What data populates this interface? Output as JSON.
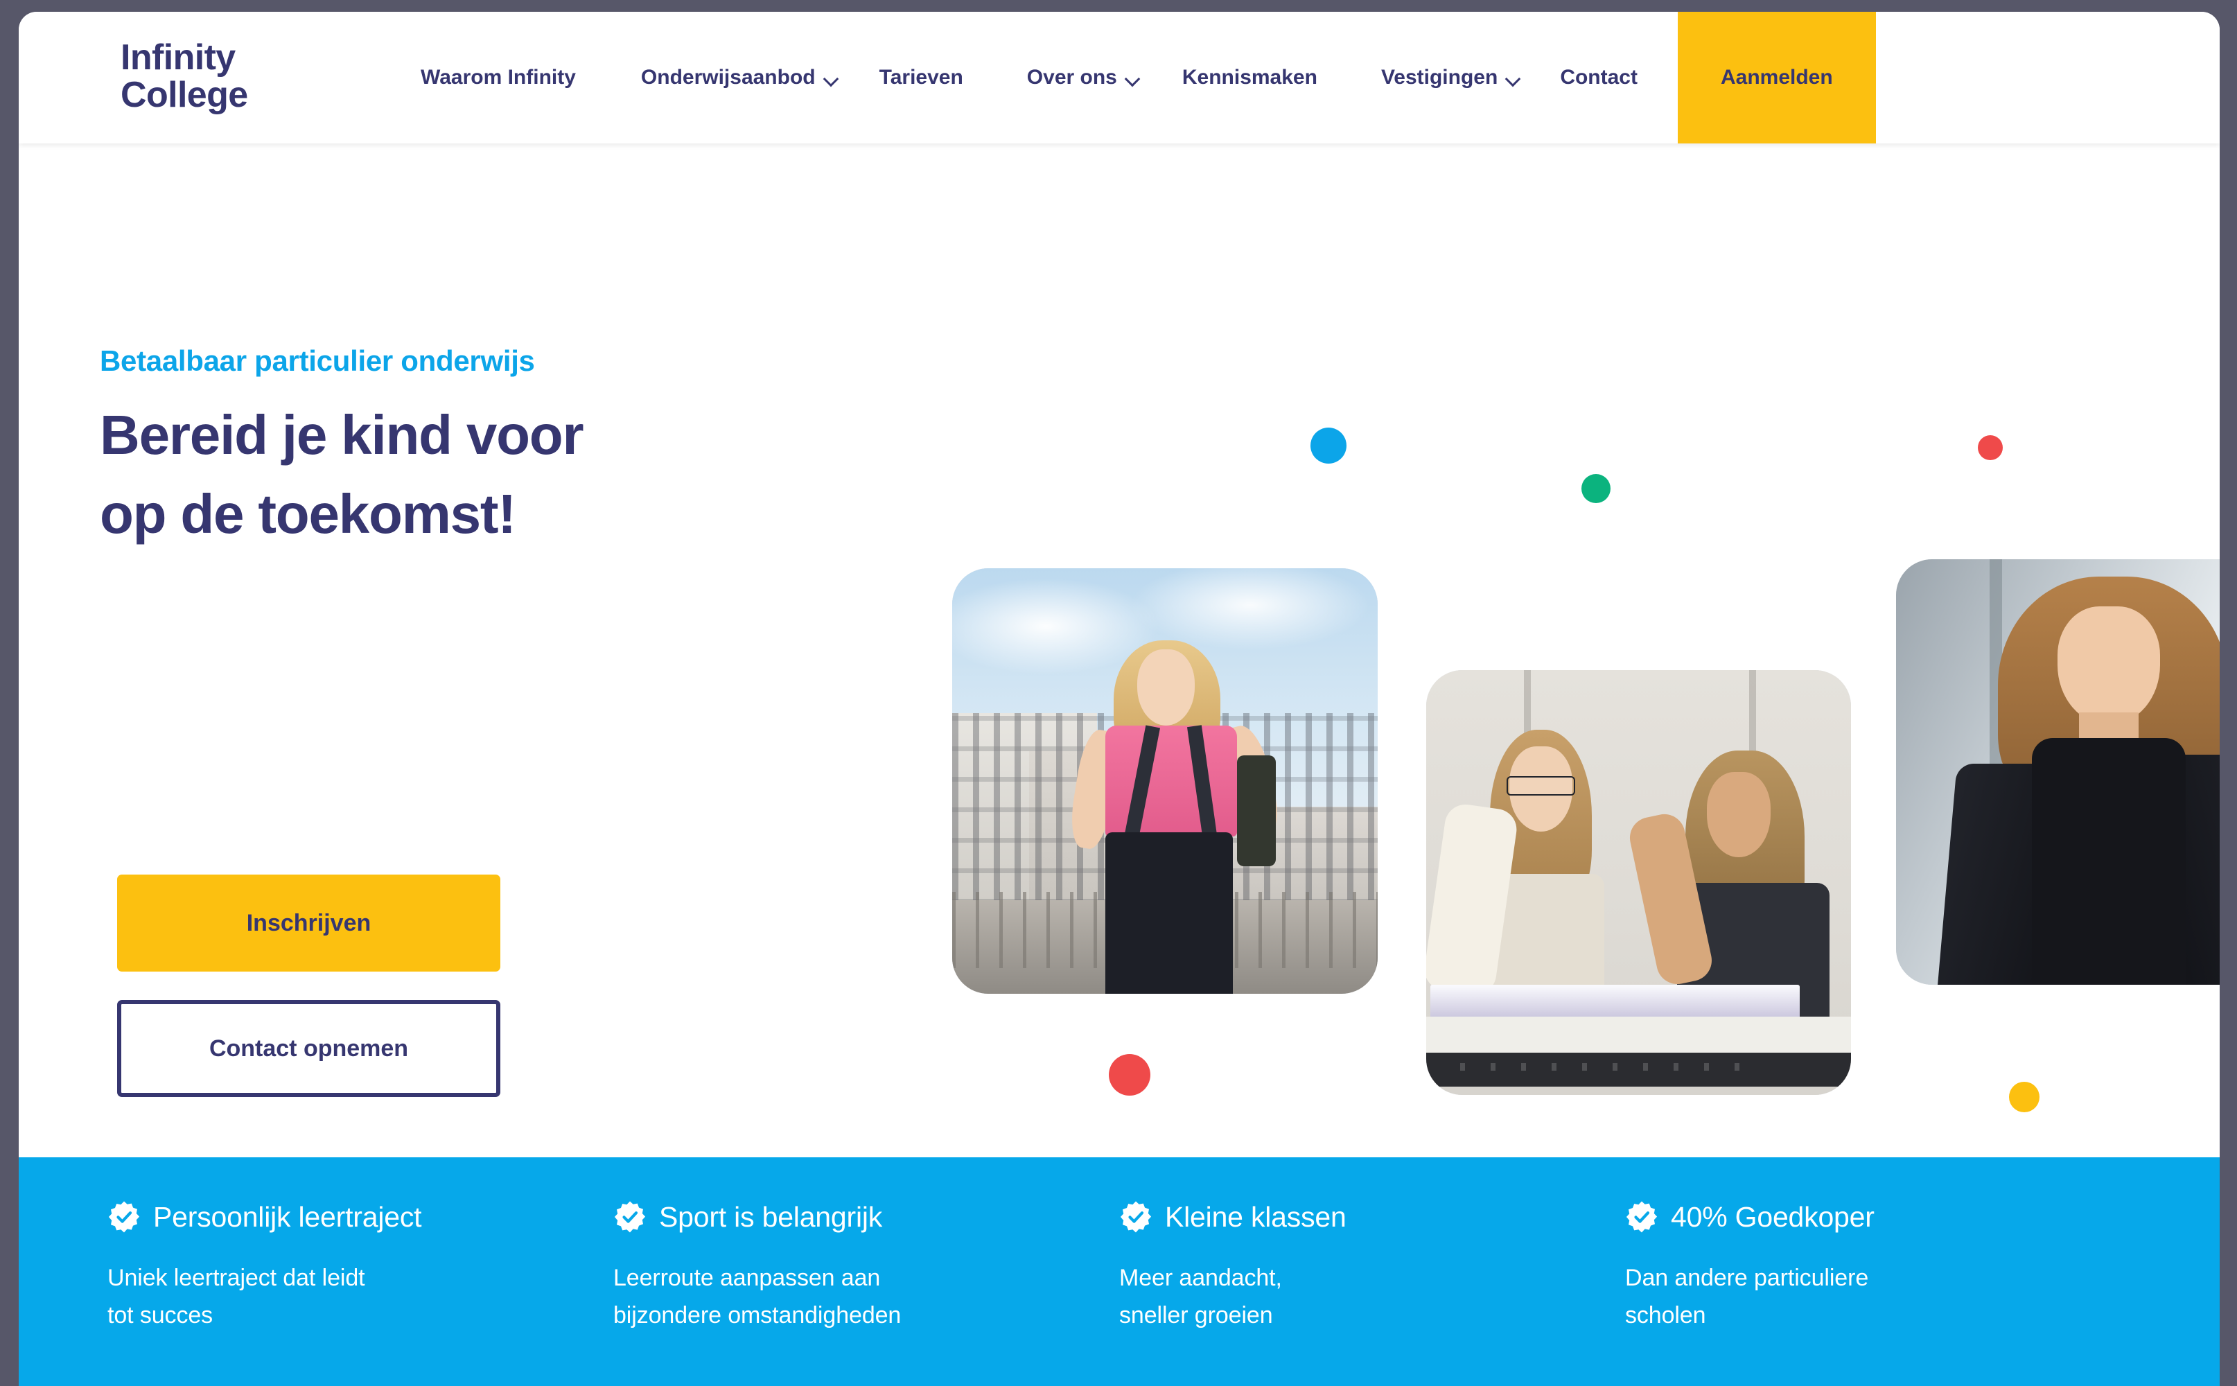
{
  "brand": {
    "name": "Infinity\nCollege"
  },
  "nav": {
    "items": [
      {
        "label": "Waarom Infinity",
        "has_dropdown": false
      },
      {
        "label": "Onderwijsaanbod",
        "has_dropdown": true
      },
      {
        "label": "Tarieven",
        "has_dropdown": false
      },
      {
        "label": "Over ons",
        "has_dropdown": true
      },
      {
        "label": "Kennismaken",
        "has_dropdown": false
      },
      {
        "label": "Vestigingen",
        "has_dropdown": true
      },
      {
        "label": "Contact",
        "has_dropdown": false
      }
    ],
    "cta": {
      "label": "Aanmelden"
    }
  },
  "hero": {
    "eyebrow": "Betaalbaar particulier onderwijs",
    "title": "Bereid je kind voor\nop de toekomst!",
    "primary_button": "Inschrijven",
    "secondary_button": "Contact opnemen"
  },
  "features": [
    {
      "title": "Persoonlijk leertraject",
      "description": "Uniek leertraject dat leidt\ntot succes"
    },
    {
      "title": "Sport is belangrijk",
      "description": "Leerroute aanpassen aan\nbijzondere omstandigheden"
    },
    {
      "title": "Kleine klassen",
      "description": "Meer aandacht,\nsneller groeien"
    },
    {
      "title": "40% Goedkoper",
      "description": "Dan andere particuliere\nscholen"
    }
  ],
  "colors": {
    "brand_navy": "#363670",
    "accent_yellow": "#FCC010",
    "accent_blue": "#0CA5E9",
    "feature_bar_blue": "#06A8EA",
    "dot_green": "#0BB37E",
    "dot_red": "#EF4A4A",
    "page_backdrop": "#575769"
  }
}
